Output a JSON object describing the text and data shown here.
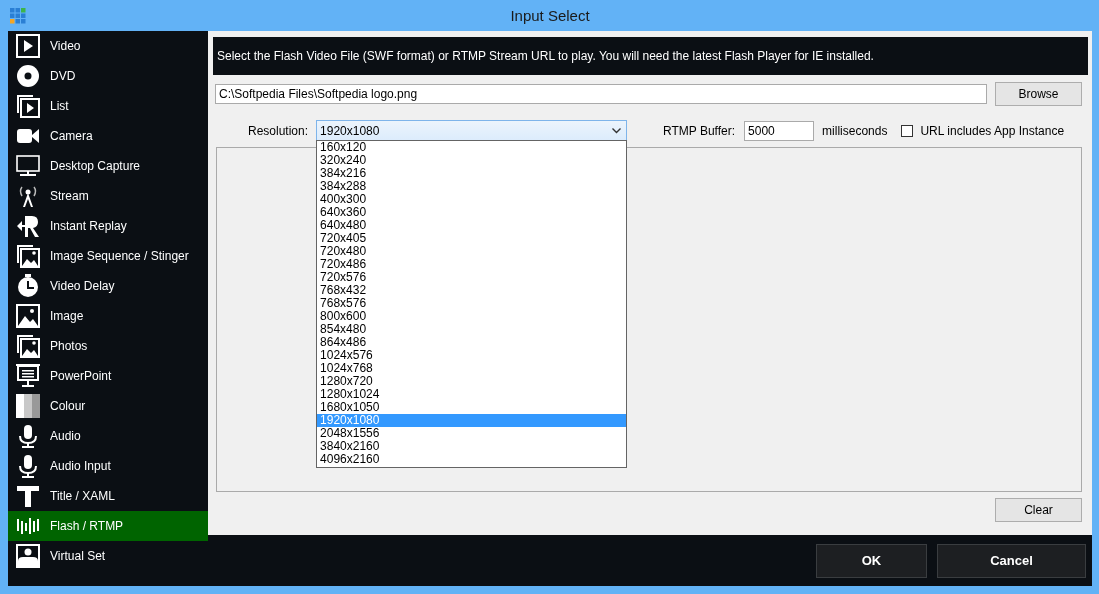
{
  "window": {
    "title": "Input Select"
  },
  "sidebar": {
    "items": [
      {
        "label": "Video",
        "selected": false
      },
      {
        "label": "DVD",
        "selected": false
      },
      {
        "label": "List",
        "selected": false
      },
      {
        "label": "Camera",
        "selected": false
      },
      {
        "label": "Desktop Capture",
        "selected": false
      },
      {
        "label": "Stream",
        "selected": false
      },
      {
        "label": "Instant Replay",
        "selected": false
      },
      {
        "label": "Image Sequence / Stinger",
        "selected": false
      },
      {
        "label": "Video Delay",
        "selected": false
      },
      {
        "label": "Image",
        "selected": false
      },
      {
        "label": "Photos",
        "selected": false
      },
      {
        "label": "PowerPoint",
        "selected": false
      },
      {
        "label": "Colour",
        "selected": false
      },
      {
        "label": "Audio",
        "selected": false
      },
      {
        "label": "Audio Input",
        "selected": false
      },
      {
        "label": "Title / XAML",
        "selected": false
      },
      {
        "label": "Flash / RTMP",
        "selected": true
      },
      {
        "label": "Virtual Set",
        "selected": false
      }
    ]
  },
  "info": "Select the Flash Video File (SWF format) or RTMP Stream URL to play. You will need the latest Flash Player for IE installed.",
  "file": {
    "value": "C:\\Softpedia Files\\Softpedia logo.png",
    "button": "Browse"
  },
  "resolution": {
    "label": "Resolution:",
    "value": "1920x1080",
    "expanded": true,
    "options": [
      {
        "label": "160x120",
        "selected": false
      },
      {
        "label": "320x240",
        "selected": false
      },
      {
        "label": "384x216",
        "selected": false
      },
      {
        "label": "384x288",
        "selected": false
      },
      {
        "label": "400x300",
        "selected": false
      },
      {
        "label": "640x360",
        "selected": false
      },
      {
        "label": "640x480",
        "selected": false
      },
      {
        "label": "720x405",
        "selected": false
      },
      {
        "label": "720x480",
        "selected": false
      },
      {
        "label": "720x486",
        "selected": false
      },
      {
        "label": "720x576",
        "selected": false
      },
      {
        "label": "768x432",
        "selected": false
      },
      {
        "label": "768x576",
        "selected": false
      },
      {
        "label": "800x600",
        "selected": false
      },
      {
        "label": "854x480",
        "selected": false
      },
      {
        "label": "864x486",
        "selected": false
      },
      {
        "label": "1024x576",
        "selected": false
      },
      {
        "label": "1024x768",
        "selected": false
      },
      {
        "label": "1280x720",
        "selected": false
      },
      {
        "label": "1280x1024",
        "selected": false
      },
      {
        "label": "1680x1050",
        "selected": false
      },
      {
        "label": "1920x1080",
        "selected": true
      },
      {
        "label": "2048x1556",
        "selected": false
      },
      {
        "label": "3840x2160",
        "selected": false
      },
      {
        "label": "4096x2160",
        "selected": false
      }
    ]
  },
  "buffer": {
    "label": "RTMP Buffer:",
    "value": "5000",
    "unit": "milliseconds"
  },
  "app_instance": {
    "label": "URL includes App Instance",
    "checked": false
  },
  "clear_button": "Clear",
  "buttons": [
    "OK",
    "Cancel"
  ]
}
